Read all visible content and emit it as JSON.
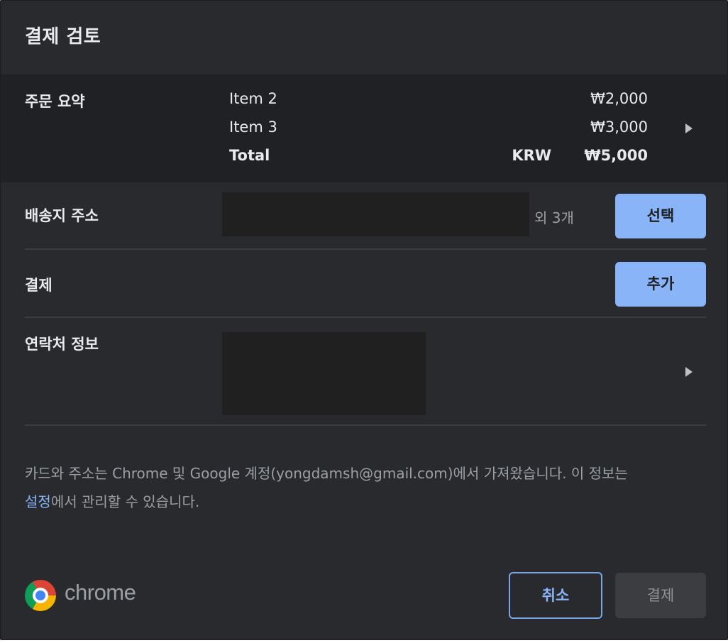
{
  "dialog": {
    "title": "결제 검토"
  },
  "order_summary": {
    "label": "주문 요약",
    "items": [
      {
        "name": "Item 2",
        "price": "₩2,000"
      },
      {
        "name": "Item 3",
        "price": "₩3,000"
      }
    ],
    "total": {
      "label": "Total",
      "currency": "KRW",
      "price": "₩5,000"
    }
  },
  "shipping": {
    "label": "배송지 주소",
    "extra": "외 3개",
    "button": "선택"
  },
  "payment": {
    "label": "결제",
    "button": "추가"
  },
  "contact": {
    "label": "연락처 정보"
  },
  "footer": {
    "text_before": "카드와 주소는 Chrome 및 Google 계정(yongdamsh@gmail.com)에서 가져왔습니다. 이 정보는 ",
    "link": "설정",
    "text_after": "에서 관리할 수 있습니다."
  },
  "brand": {
    "wordmark": "chrome",
    "logo_icon": "chrome-logo-icon"
  },
  "actions": {
    "cancel": "취소",
    "pay": "결제"
  },
  "colors": {
    "background": "#292a2d",
    "section_background": "#202124",
    "accent": "#8ab4f8"
  }
}
